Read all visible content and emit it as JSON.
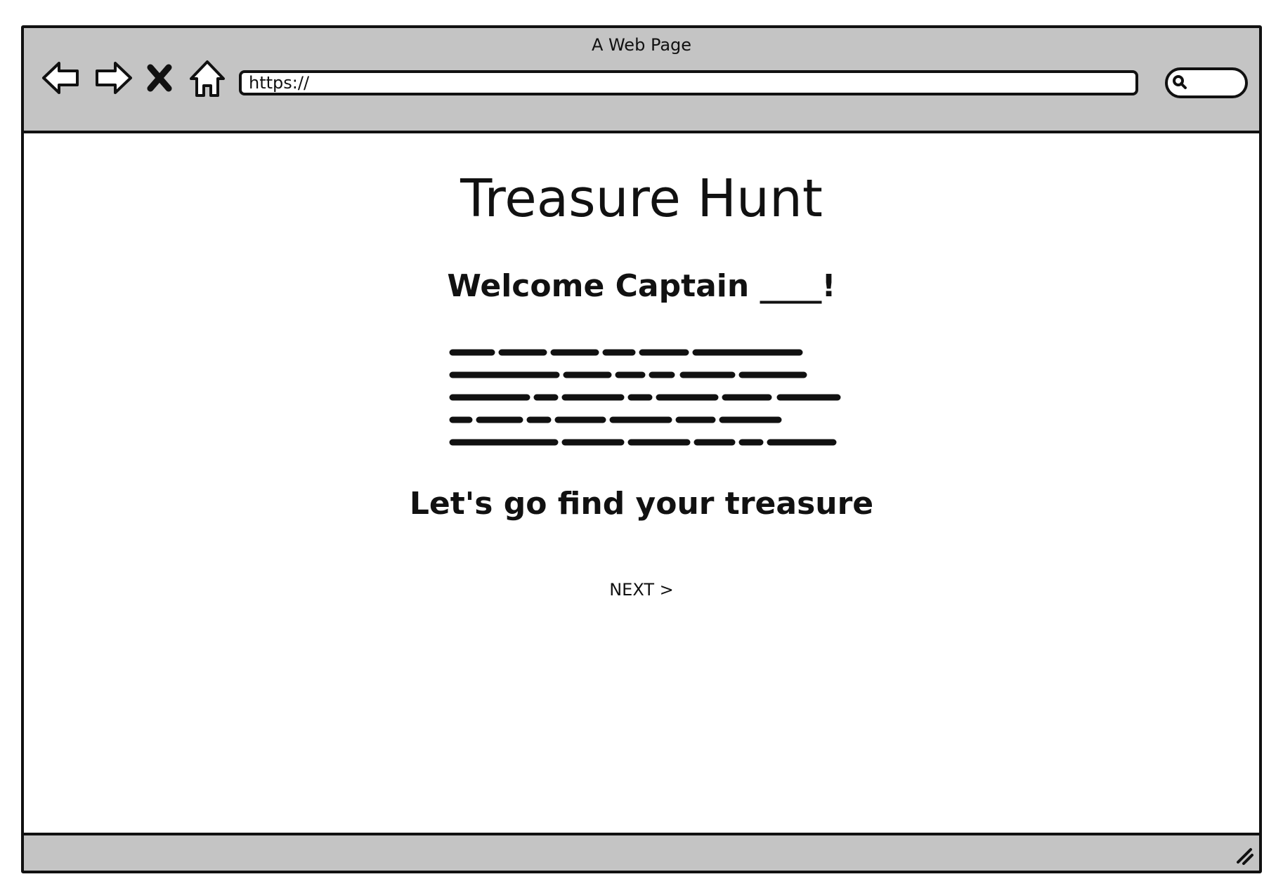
{
  "window": {
    "title": "A Web Page"
  },
  "toolbar": {
    "back_icon": "back-arrow-icon",
    "forward_icon": "forward-arrow-icon",
    "stop_icon": "close-icon",
    "home_icon": "home-icon",
    "url": "https://",
    "search_icon": "search-icon"
  },
  "page": {
    "title": "Treasure Hunt",
    "welcome": "Welcome Captain ____!",
    "tagline": "Let's go find your treasure",
    "next_label": "NEXT >"
  },
  "colors": {
    "chrome": "#c4c4c4",
    "outline": "#111111",
    "background": "#ffffff"
  }
}
